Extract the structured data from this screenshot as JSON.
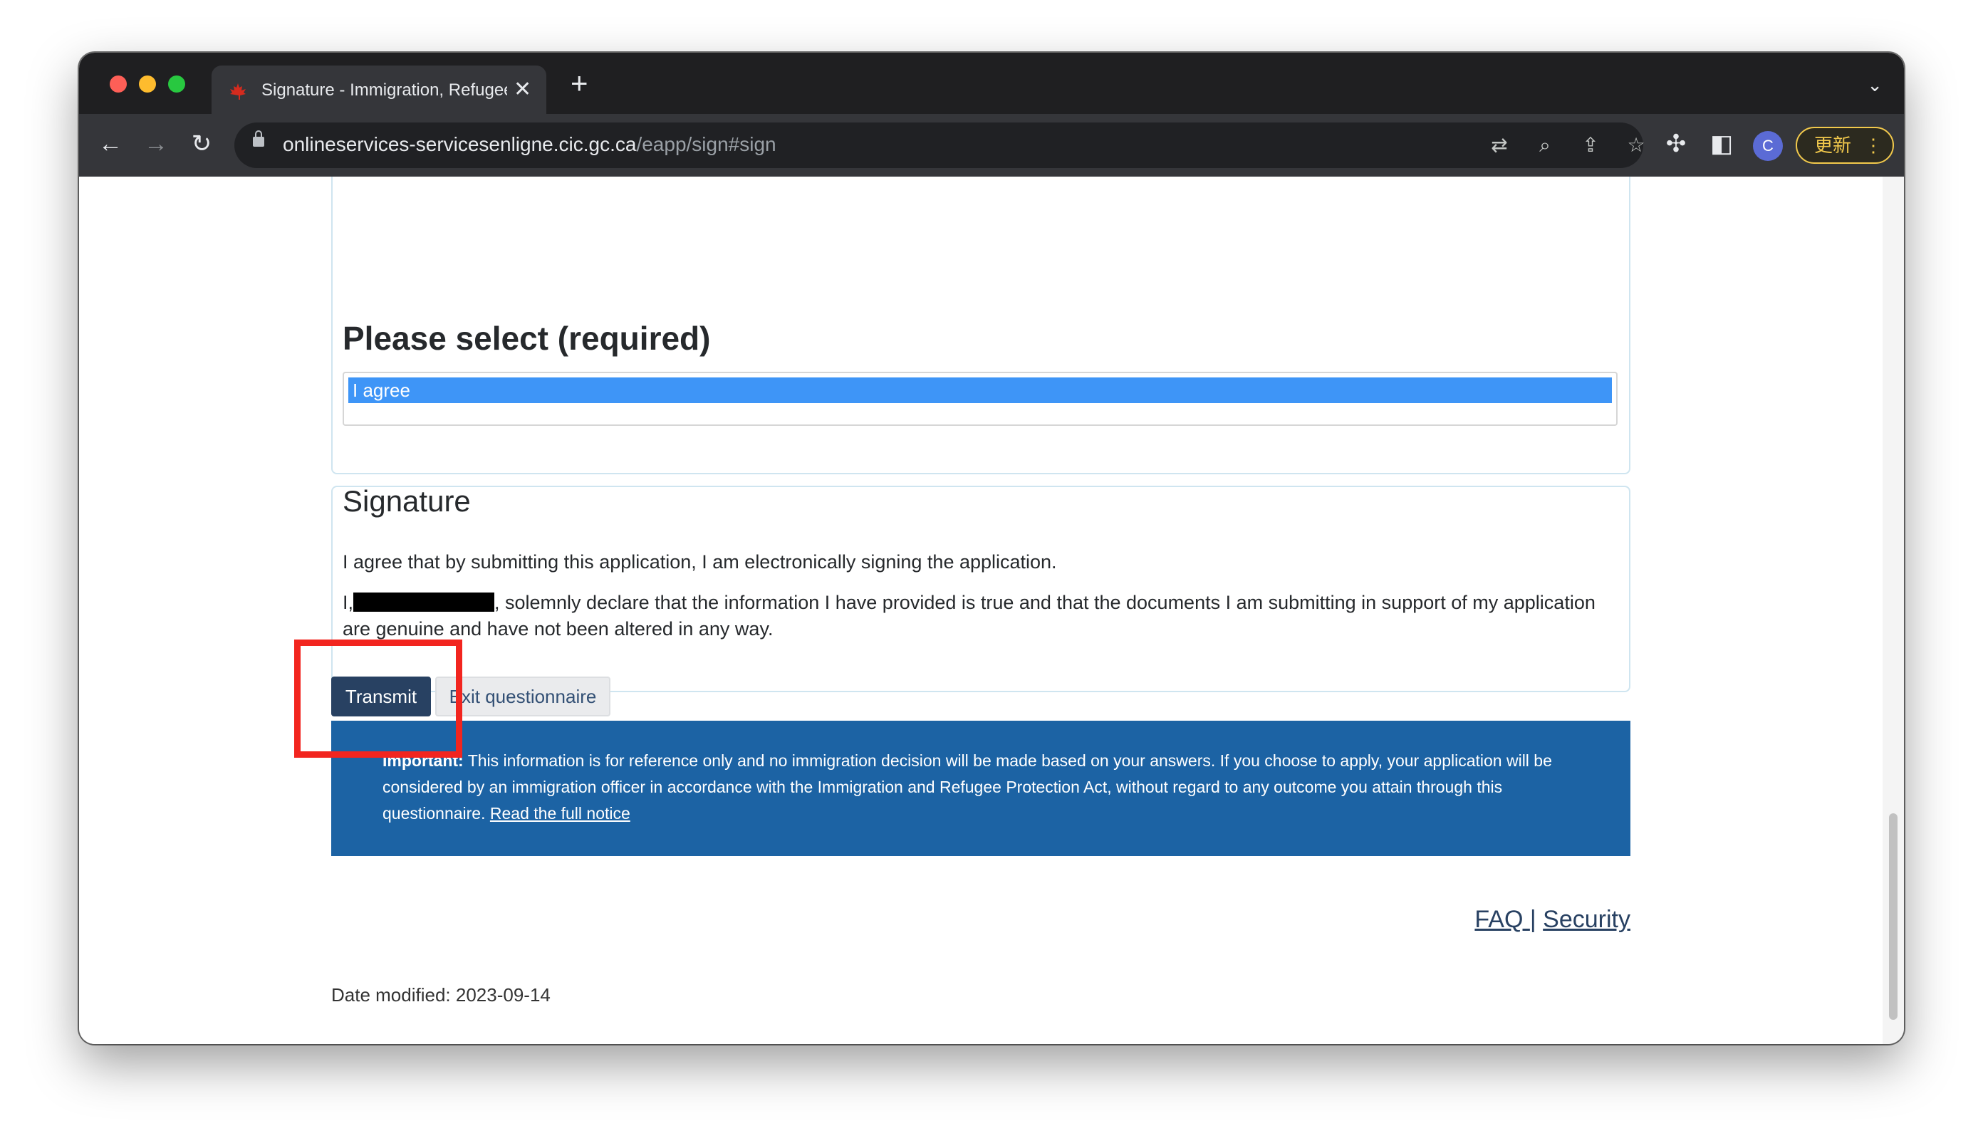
{
  "browser": {
    "tab_title": "Signature - Immigration, Refugees and Citizenship Canada",
    "url_host": "onlineservices-servicesenligne.cic.gc.ca",
    "url_path": "/eapp/sign#sign",
    "profile_initial": "C",
    "update_label": "更新"
  },
  "page": {
    "select_heading": "Please select (required)",
    "selected_option": "I agree",
    "signature_heading": "Signature",
    "signature_statement": "I agree that by submitting this application, I am electronically signing the application.",
    "declaration_prefix": "I,",
    "declaration_suffix": ", solemnly declare that the information I have provided is true and that the documents I am submitting in support of my application are genuine and have not been altered in any way.",
    "transmit_label": "Transmit",
    "exit_label": "Exit questionnaire",
    "notice_bold": "Important:",
    "notice_text": " This information is for reference only and no immigration decision will be made based on your answers. If you choose to apply, your application will be considered by an immigration officer in accordance with the Immigration and Refugee Protection Act, without regard to any outcome you attain through this questionnaire. ",
    "notice_link": "Read the full notice",
    "faq_label": "FAQ ",
    "separator": "|",
    "security_label": "Security",
    "date_modified": "Date modified: 2023-09-14"
  },
  "icons": {
    "back": "arrow-left-icon",
    "forward": "arrow-right-icon",
    "reload": "reload-icon",
    "translate": "translate-icon",
    "zoom": "zoom-icon",
    "share": "share-icon",
    "bookmark": "star-icon",
    "extensions": "puzzle-icon",
    "sidepanel": "side-panel-icon"
  },
  "colors": {
    "highlight": "#f2251f",
    "transmit_bg": "#284162",
    "notice_bg": "#1c63a4",
    "selected_bg": "#3e95f7"
  }
}
